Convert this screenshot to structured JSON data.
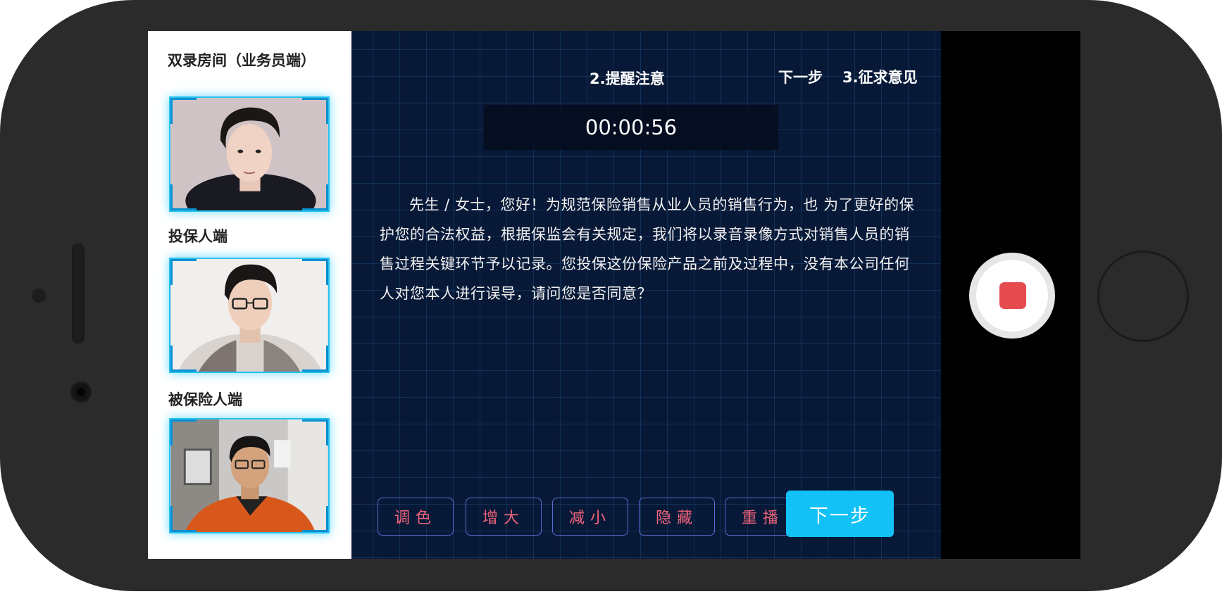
{
  "sidebar": {
    "title": "双录房间（业务员端）",
    "cameras": [
      {
        "label": ""
      },
      {
        "label": "投保人端"
      },
      {
        "label": "被保险人端"
      }
    ]
  },
  "header": {
    "current_step": "2.提醒注意",
    "next_label": "下一步",
    "next_step": "3.征求意见"
  },
  "timer": "00:00:56",
  "script_text": "先生 / 女士，您好！为规范保险销售从业人员的销售行为，也 为了更好的保护您的合法权益，根据保监会有关规定，我们将以录音录像方式对销售人员的销售过程关键环节予以记录。您投保这份保险产品之前及过程中，没有本公司任何人对您本人进行误导，请问您是否同意？",
  "controls": [
    "调色",
    "增大",
    "减小",
    "隐藏",
    "重播"
  ],
  "next_button": "下一步",
  "colors": {
    "accent": "#12c1f6",
    "control_text": "#f0637a",
    "record_stop": "#e54a4f",
    "background": "#081937"
  },
  "icons": {
    "record": "record-stop-icon"
  }
}
